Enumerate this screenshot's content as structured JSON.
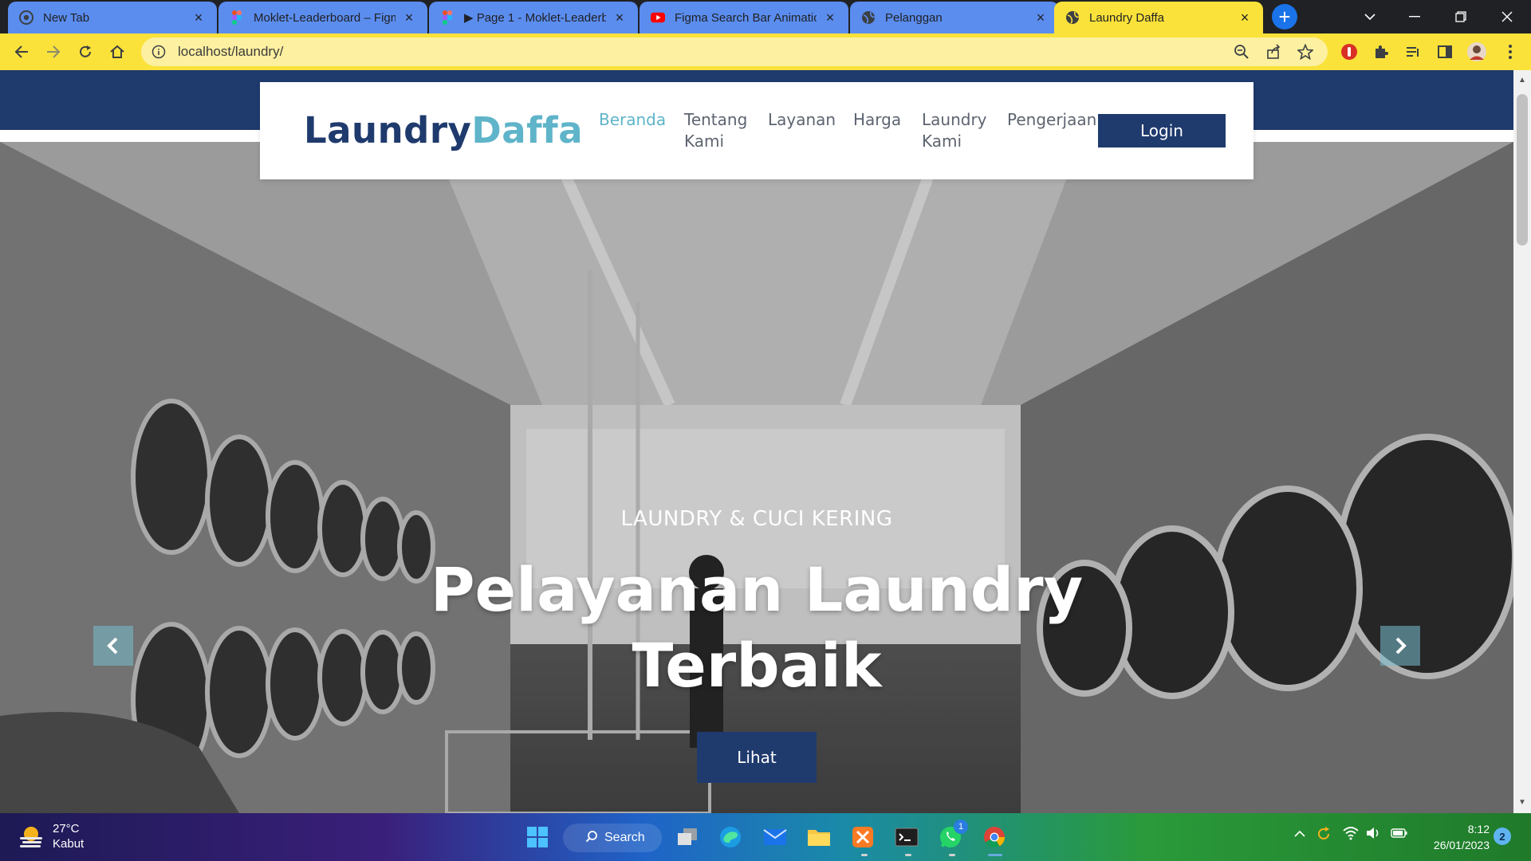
{
  "browser": {
    "tabs": [
      {
        "title": "New Tab",
        "favicon": "chrome-icon",
        "active": false
      },
      {
        "title": "Moklet-Leaderboard – Figma",
        "favicon": "figma-icon",
        "active": false
      },
      {
        "title": "▶ Page 1 - Moklet-Leaderboard",
        "favicon": "figma-icon",
        "active": false
      },
      {
        "title": "Figma Search Bar Animation",
        "favicon": "youtube-icon",
        "active": false
      },
      {
        "title": "Pelanggan",
        "favicon": "globe-icon",
        "active": false
      },
      {
        "title": "Laundry Daffa",
        "favicon": "globe-icon",
        "active": true
      }
    ],
    "url": "localhost/laundry/",
    "colors": {
      "tab_bg": "#5b8def",
      "active_tab": "#fbe23a",
      "toolbar": "#fbe23a"
    }
  },
  "site": {
    "brand_part1": "Laundry",
    "brand_part2": "Daffa",
    "nav": [
      {
        "label_line1": "Beranda",
        "label_line2": "",
        "active": true
      },
      {
        "label_line1": "Tentang",
        "label_line2": "Kami",
        "active": false
      },
      {
        "label_line1": "Layanan",
        "label_line2": "",
        "active": false
      },
      {
        "label_line1": "Harga",
        "label_line2": "",
        "active": false
      },
      {
        "label_line1": "Laundry",
        "label_line2": "Kami",
        "active": false
      },
      {
        "label_line1": "Pengerjaan",
        "label_line2": "",
        "active": false
      }
    ],
    "login_label": "Login",
    "hero": {
      "subtitle": "LAUNDRY & CUCI KERING",
      "title": "Pelayanan Laundry Terbaik",
      "button_label": "Lihat"
    },
    "colors": {
      "primary": "#1f3a6d",
      "accent": "#5fb4c9",
      "nav_text": "#5d6470"
    }
  },
  "taskbar": {
    "weather_temp": "27°C",
    "weather_cond": "Kabut",
    "search_label": "Search",
    "time": "8:12",
    "date": "26/01/2023",
    "notifications": "2",
    "whatsapp_badge": "1"
  }
}
